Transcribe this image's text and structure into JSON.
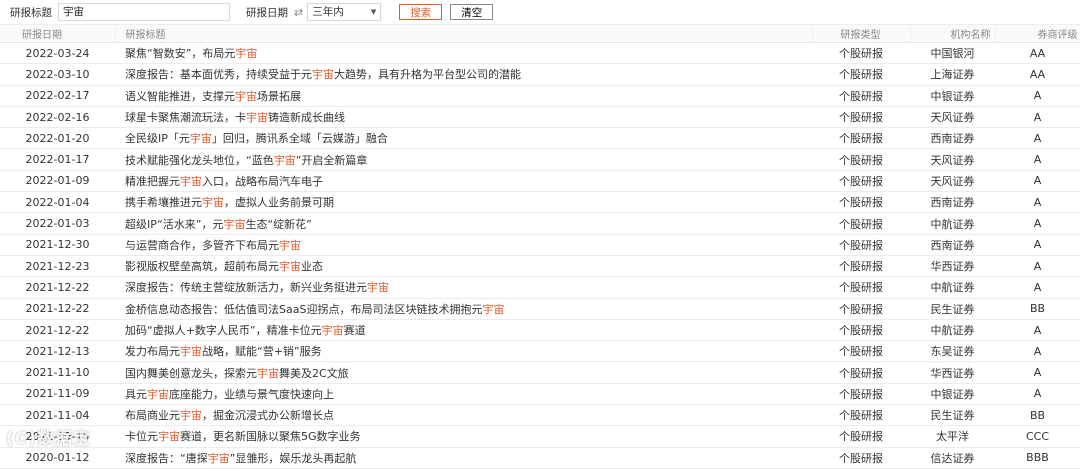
{
  "toolbar": {
    "title_label": "研报标题",
    "title_value": "宇宙",
    "date_label": "研报日期",
    "date_value": "三年内",
    "search_button": "搜索",
    "clear_button": "清空"
  },
  "table": {
    "headers": {
      "date": "研报日期",
      "title": "研报标题",
      "type": "研报类型",
      "org": "机构名称",
      "rating": "券商评级"
    },
    "rows": [
      {
        "date": "2022-03-24",
        "pre": "聚焦“智数安”，布局元",
        "hl": "宇宙",
        "post": "",
        "type": "个股研报",
        "org": "中国银河",
        "rating": "AA"
      },
      {
        "date": "2022-03-10",
        "pre": "深度报告：基本面优秀，持续受益于元",
        "hl": "宇宙",
        "post": "大趋势，具有升格为平台型公司的潜能",
        "type": "个股研报",
        "org": "上海证券",
        "rating": "AA"
      },
      {
        "date": "2022-02-17",
        "pre": "语义智能推进，支撑元",
        "hl": "宇宙",
        "post": "场景拓展",
        "type": "个股研报",
        "org": "中银证券",
        "rating": "A"
      },
      {
        "date": "2022-02-16",
        "pre": "球星卡聚焦潮流玩法，卡",
        "hl": "宇宙",
        "post": "铸造新成长曲线",
        "type": "个股研报",
        "org": "天风证券",
        "rating": "A"
      },
      {
        "date": "2022-01-20",
        "pre": "全民级IP「元",
        "hl": "宇宙",
        "post": "」回归，腾讯系全域「云媒游」融合",
        "type": "个股研报",
        "org": "西南证券",
        "rating": "A"
      },
      {
        "date": "2022-01-17",
        "pre": "技术赋能强化龙头地位，“蓝色",
        "hl": "宇宙",
        "post": "”开启全新篇章",
        "type": "个股研报",
        "org": "天风证券",
        "rating": "A"
      },
      {
        "date": "2022-01-09",
        "pre": "精准把握元",
        "hl": "宇宙",
        "post": "入口，战略布局汽车电子",
        "type": "个股研报",
        "org": "天风证券",
        "rating": "A"
      },
      {
        "date": "2022-01-04",
        "pre": "携手希壤推进元",
        "hl": "宇宙",
        "post": "，虚拟人业务前景可期",
        "type": "个股研报",
        "org": "西南证券",
        "rating": "A"
      },
      {
        "date": "2022-01-03",
        "pre": "超级IP“活水来”，元",
        "hl": "宇宙",
        "post": "生态“绽新花”",
        "type": "个股研报",
        "org": "中航证券",
        "rating": "A"
      },
      {
        "date": "2021-12-30",
        "pre": "与运营商合作，多管齐下布局元",
        "hl": "宇宙",
        "post": "",
        "type": "个股研报",
        "org": "西南证券",
        "rating": "A"
      },
      {
        "date": "2021-12-23",
        "pre": "影视版权壁垒高筑，超前布局元",
        "hl": "宇宙",
        "post": "业态",
        "type": "个股研报",
        "org": "华西证券",
        "rating": "A"
      },
      {
        "date": "2021-12-22",
        "pre": "深度报告：传统主营绽放新活力，新兴业务挺进元",
        "hl": "宇宙",
        "post": "",
        "type": "个股研报",
        "org": "中航证券",
        "rating": "A"
      },
      {
        "date": "2021-12-22",
        "pre": "金桥信息动态报告：低估值司法SaaS迎拐点，布局司法区块链技术拥抱元",
        "hl": "宇宙",
        "post": "",
        "type": "个股研报",
        "org": "民生证券",
        "rating": "BB"
      },
      {
        "date": "2021-12-22",
        "pre": "加码“虚拟人+数字人民币”，精准卡位元",
        "hl": "宇宙",
        "post": "赛道",
        "type": "个股研报",
        "org": "中航证券",
        "rating": "A"
      },
      {
        "date": "2021-12-13",
        "pre": "发力布局元",
        "hl": "宇宙",
        "post": "战略，赋能“营+销”服务",
        "type": "个股研报",
        "org": "东吴证券",
        "rating": "A"
      },
      {
        "date": "2021-11-10",
        "pre": "国内舞美创意龙头，探索元",
        "hl": "宇宙",
        "post": "舞美及2C文旅",
        "type": "个股研报",
        "org": "华西证券",
        "rating": "A"
      },
      {
        "date": "2021-11-09",
        "pre": "具元",
        "hl": "宇宙",
        "post": "底座能力，业绩与景气度快速向上",
        "type": "个股研报",
        "org": "中银证券",
        "rating": "A"
      },
      {
        "date": "2021-11-04",
        "pre": "布局商业元",
        "hl": "宇宙",
        "post": "，掘金沉浸式办公新增长点",
        "type": "个股研报",
        "org": "民生证券",
        "rating": "BB"
      },
      {
        "date": "2021-09-15",
        "pre": "卡位元",
        "hl": "宇宙",
        "post": "赛道，更名新国脉以聚焦5G数字业务",
        "type": "个股研报",
        "org": "太平洋",
        "rating": "CCC"
      },
      {
        "date": "2020-01-12",
        "pre": "深度报告：“唐探",
        "hl": "宇宙",
        "post": "”显雏形，娱乐龙头再起航",
        "type": "个股研报",
        "org": "信达证券",
        "rating": "BBB"
      }
    ]
  },
  "watermark": "(C)数据宝",
  "colors": {
    "highlight": "#e05a2b"
  }
}
